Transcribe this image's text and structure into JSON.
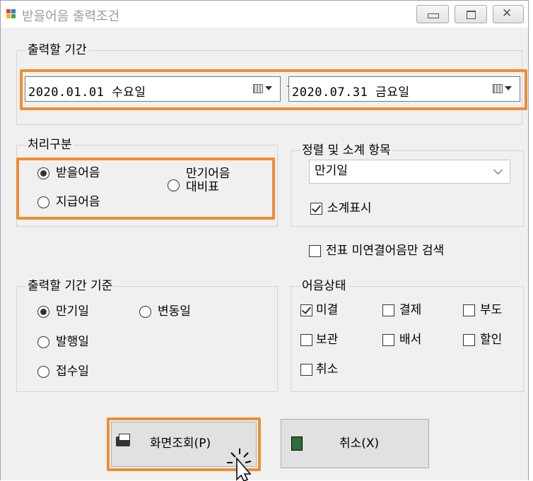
{
  "window": {
    "title": "받을어음 출력조건"
  },
  "titlebar": {
    "minimize_glyph": "▭",
    "maximize_glyph": "▣",
    "close_glyph": "✕"
  },
  "period": {
    "label": "출력할 기간",
    "from": "2020.01.01 수요일",
    "separator": "~",
    "to": "2020.07.31 금요일"
  },
  "process_type": {
    "label": "처리구분",
    "options": [
      "받을어음",
      "지급어음",
      "만기어음\n대비표"
    ],
    "selected": "받을어음"
  },
  "sort": {
    "label": "정렬 및 소계 항목",
    "selected": "만기일",
    "subtotal_label": "소계표시",
    "subtotal_checked": true
  },
  "unlinked_only": {
    "label": "전표 미연결어음만 검색",
    "checked": false
  },
  "period_basis": {
    "label": "출력할 기간 기준",
    "options": [
      "만기일",
      "변동일",
      "발행일",
      "접수일"
    ],
    "selected": "만기일"
  },
  "status": {
    "label": "어음상태",
    "items": [
      {
        "label": "미결",
        "checked": true
      },
      {
        "label": "결제",
        "checked": false
      },
      {
        "label": "부도",
        "checked": false
      },
      {
        "label": "보관",
        "checked": false
      },
      {
        "label": "배서",
        "checked": false
      },
      {
        "label": "할인",
        "checked": false
      },
      {
        "label": "취소",
        "checked": false
      }
    ]
  },
  "buttons": {
    "view": "화면조회(P)",
    "cancel": "취소(X)"
  },
  "colors": {
    "highlight": "#f08c35",
    "window_bg": "#f0f0f0"
  }
}
